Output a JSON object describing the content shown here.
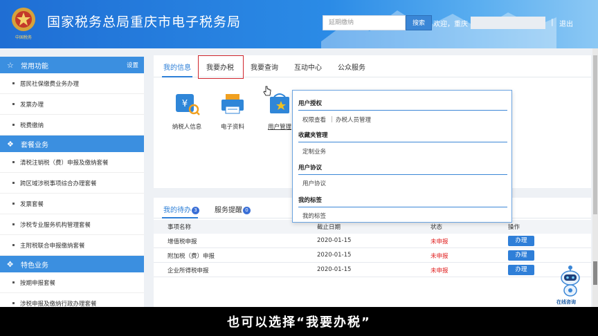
{
  "header": {
    "title": "国家税务总局重庆市电子税务局",
    "search_placeholder": "延期缴纳",
    "search_button": "搜索",
    "welcome": "欢迎，重庆",
    "separator": "|",
    "logout": "退出",
    "emblem_text": "中国税务"
  },
  "sidebar": {
    "groups": [
      {
        "title": "常用功能",
        "icon": "star-icon",
        "action": "设置",
        "items": [
          "居民社保缴费业务办理",
          "发票办理",
          "税费缴纳"
        ]
      },
      {
        "title": "套餐业务",
        "icon": "layers-icon",
        "items": [
          "清税注销税（费）申报及缴纳套餐",
          "跨区域涉税事项综合办理套餐",
          "发票套餐",
          "涉税专业服务机构管理套餐",
          "主附税联合申报缴纳套餐"
        ]
      },
      {
        "title": "特色业务",
        "icon": "grid-icon",
        "items": [
          "按期申报套餐",
          "涉税申报及缴纳行政办理套餐"
        ]
      }
    ]
  },
  "main": {
    "tabs": [
      "我的信息",
      "我要办税",
      "我要查询",
      "互动中心",
      "公众服务"
    ],
    "tiles": [
      {
        "label": "纳税人信息",
        "icon": "taxpayer-info-icon"
      },
      {
        "label": "电子资料",
        "icon": "e-documents-icon"
      },
      {
        "label": "用户管理",
        "icon": "user-management-icon"
      }
    ]
  },
  "dropdown": {
    "sections": [
      {
        "title": "用户授权",
        "items": [
          "权限查看",
          "办税人员管理"
        ]
      },
      {
        "title": "收藏夹管理",
        "items": [
          "定制业务"
        ]
      },
      {
        "title": "用户协议",
        "items": [
          "用户协议"
        ]
      },
      {
        "title": "我的标签",
        "items": [
          "我的标签"
        ]
      }
    ]
  },
  "pending": {
    "tabs": [
      {
        "label": "我的待办",
        "badge": "3"
      },
      {
        "label": "服务提醒",
        "badge": "0"
      }
    ],
    "headers": [
      "事项名称",
      "截止日期",
      "状态",
      "操作"
    ],
    "rows": [
      {
        "name": "增值税申报",
        "date": "2020-01-15",
        "status": "未申报",
        "action": "办理"
      },
      {
        "name": "附加税（费）申报",
        "date": "2020-01-15",
        "status": "未申报",
        "action": "办理"
      },
      {
        "name": "企业所得税申报",
        "date": "2020-01-15",
        "status": "未申报",
        "action": "办理"
      }
    ]
  },
  "assistant": {
    "label": "在线咨询"
  },
  "subtitle": "也可以选择“我要办税”",
  "colors": {
    "primary": "#2d7fd7",
    "header": "#1f6ed4",
    "status_red": "#e02020",
    "highlight": "#d0242b"
  }
}
